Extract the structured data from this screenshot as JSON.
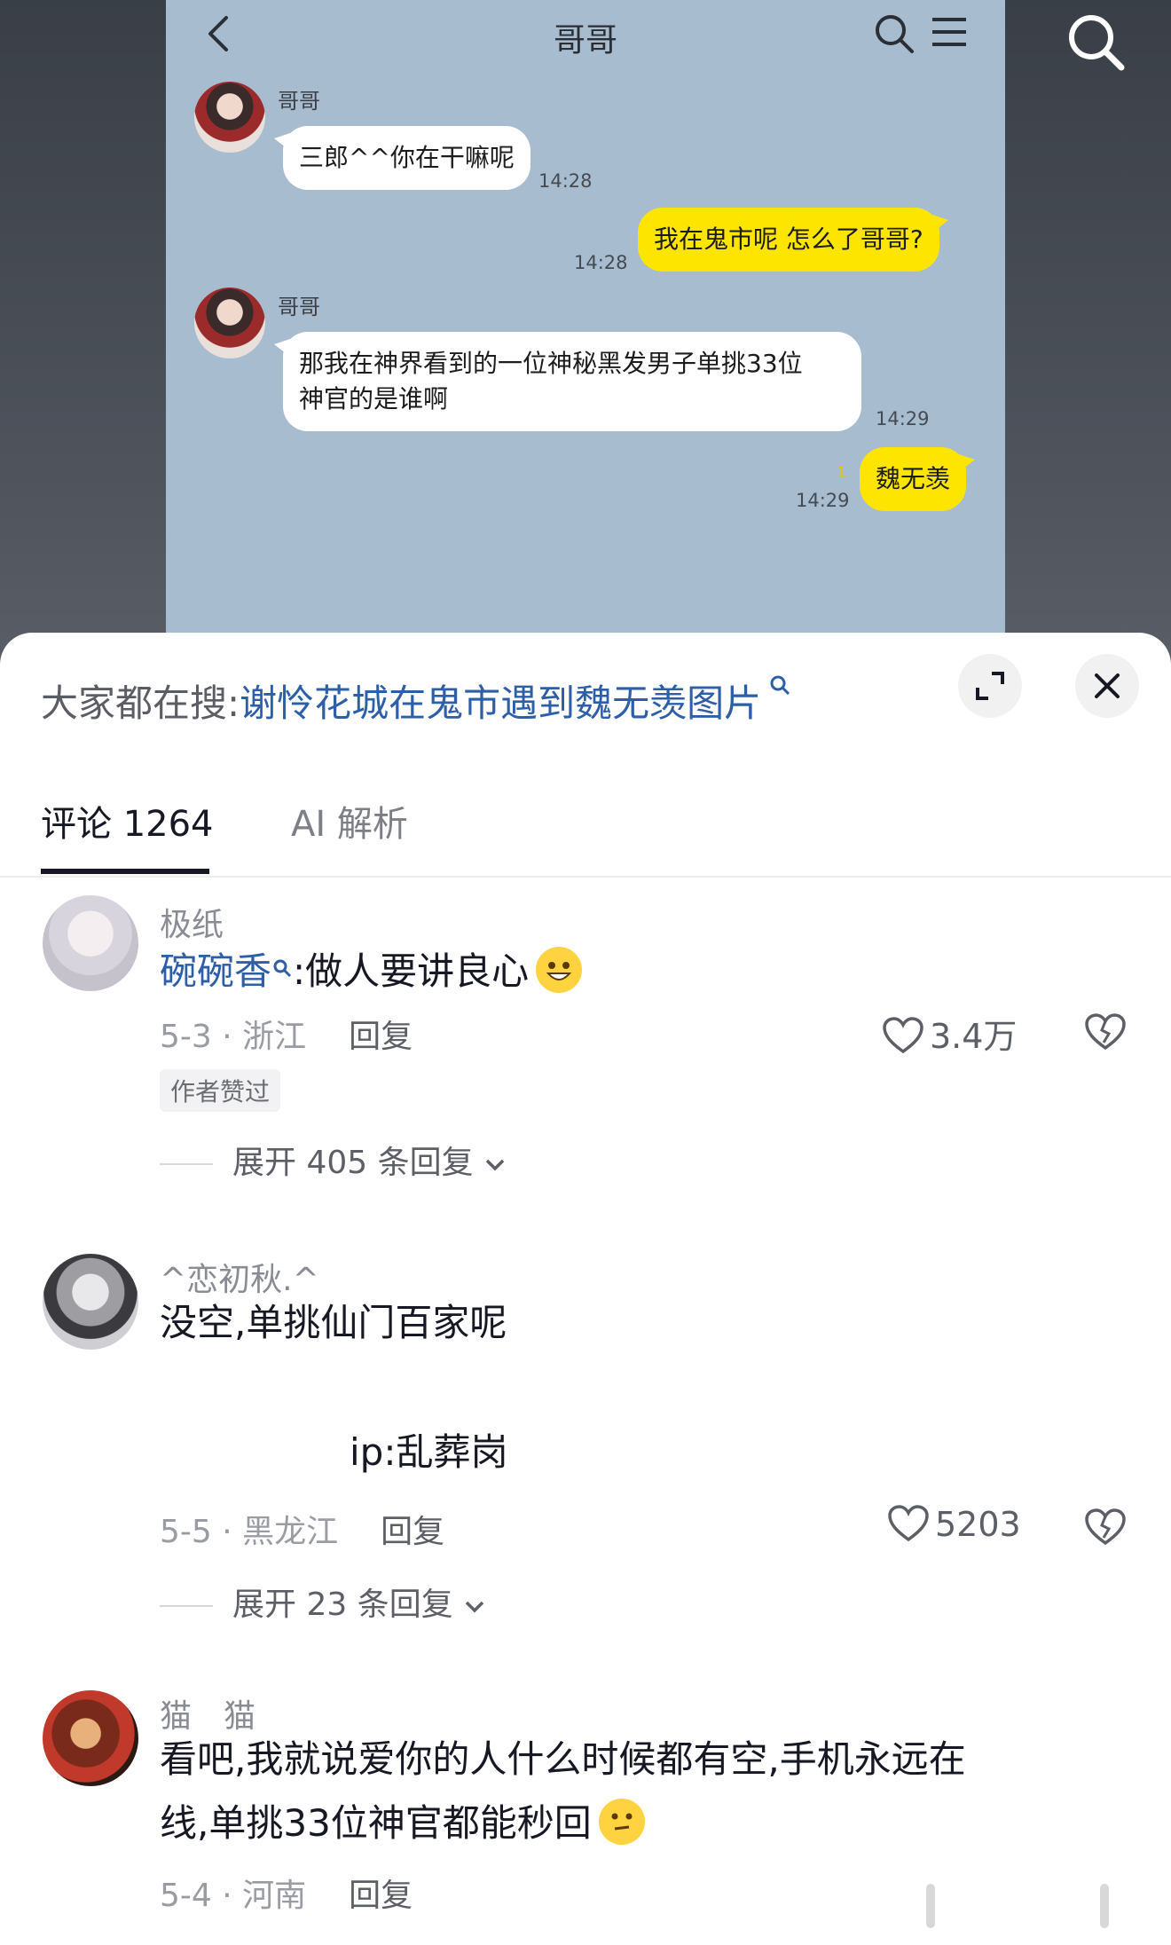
{
  "chat": {
    "title": "哥哥",
    "messages": [
      {
        "sender": "哥哥",
        "text": "三郎^^你在干嘛呢",
        "time": "14:28",
        "side": "left"
      },
      {
        "text": "我在鬼市呢 怎么了哥哥?",
        "time": "14:28",
        "side": "right"
      },
      {
        "sender": "哥哥",
        "text_line1": "那我在神界看到的一位神秘黑发男子单挑33位",
        "text_line2": "神官的是谁啊",
        "time": "14:29",
        "side": "left"
      },
      {
        "text": "魏无羡",
        "time": "14:29",
        "read": "1",
        "side": "right"
      }
    ]
  },
  "panel": {
    "hot_search_prefix": "大家都在搜:",
    "hot_search_keyword": "谢怜花城在鬼市遇到魏无羡图片",
    "tabs": [
      {
        "label": "评论 1264",
        "active": true
      },
      {
        "label": "AI 解析",
        "active": false
      }
    ]
  },
  "comments": [
    {
      "user": "极纸",
      "mention": "碗碗香",
      "text": ":做人要讲良心",
      "date_region": "5-3 · 浙江",
      "reply": "回复",
      "likes": "3.4万",
      "author_tag": "作者赞过",
      "expand": "展开 405 条回复"
    },
    {
      "user": "^恋初秋.^",
      "text_line1": "没空,单挑仙门百家呢",
      "text_line2": "ip:乱葬岗",
      "date_region": "5-5 · 黑龙江",
      "reply": "回复",
      "likes": "5203",
      "expand": "展开 23 条回复"
    },
    {
      "user": "猫　猫",
      "text_line1": "看吧,我就说爱你的人什么时候都有空,手机永远在",
      "text_line2": "线,单挑33位神官都能秒回",
      "date_region": "5-4 · 河南",
      "reply": "回复"
    }
  ],
  "colors": {
    "chat_bg": "#a8bccf",
    "bubble_yellow": "#fee500",
    "link_blue": "#2c5fa8"
  }
}
